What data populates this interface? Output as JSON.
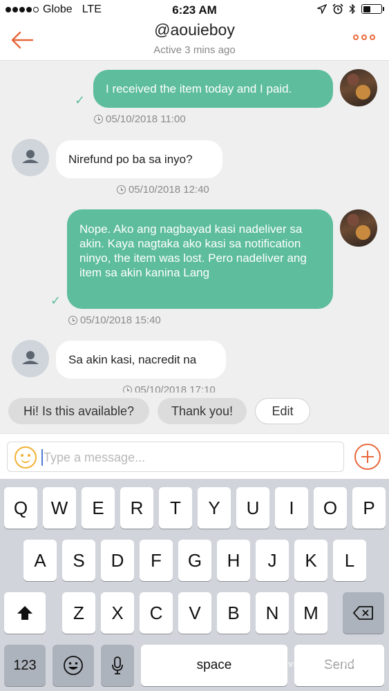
{
  "status_bar": {
    "carrier": "Globe",
    "network": "LTE",
    "time": "6:23 AM",
    "battery_level": 0.4
  },
  "header": {
    "title": "@aouieboy",
    "subtitle": "Active 3 mins ago",
    "accent": "#e8673a"
  },
  "messages": [
    {
      "direction": "out",
      "text": "I received the item today and I paid.",
      "timestamp": "05/10/2018 11:00",
      "check": "✓"
    },
    {
      "direction": "in",
      "text": "Nirefund po ba sa inyo?",
      "timestamp": "05/10/2018 12:40"
    },
    {
      "direction": "out",
      "text": "Nope. Ako ang nagbayad kasi nadeliver sa akin. Kaya nagtaka ako kasi sa notification ninyo, the item was lost. Pero nadeliver ang item sa akin kanina Lang",
      "timestamp": "05/10/2018 15:40",
      "check": "✓"
    },
    {
      "direction": "in",
      "text": "Sa akin kasi, nacredit na",
      "timestamp": "05/10/2018 17:10"
    }
  ],
  "quick_replies": [
    "Hi! Is this available?",
    "Thank you!",
    "Edit"
  ],
  "composer": {
    "placeholder": "Type a message..."
  },
  "keyboard": {
    "row1": [
      "Q",
      "W",
      "E",
      "R",
      "T",
      "Y",
      "U",
      "I",
      "O",
      "P"
    ],
    "row2": [
      "A",
      "S",
      "D",
      "F",
      "G",
      "H",
      "J",
      "K",
      "L"
    ],
    "row3": [
      "Z",
      "X",
      "C",
      "V",
      "B",
      "N",
      "M"
    ],
    "numbers_label": "123",
    "space_label": "space",
    "return_label": "Send"
  },
  "watermark": {
    "line1": "LAINTS",
    "line2": "RESOLVING SINCE 2004"
  },
  "colors": {
    "outgoing_bubble": "#5dbd9d",
    "incoming_bubble": "#ffffff",
    "accent": "#e8673a"
  }
}
